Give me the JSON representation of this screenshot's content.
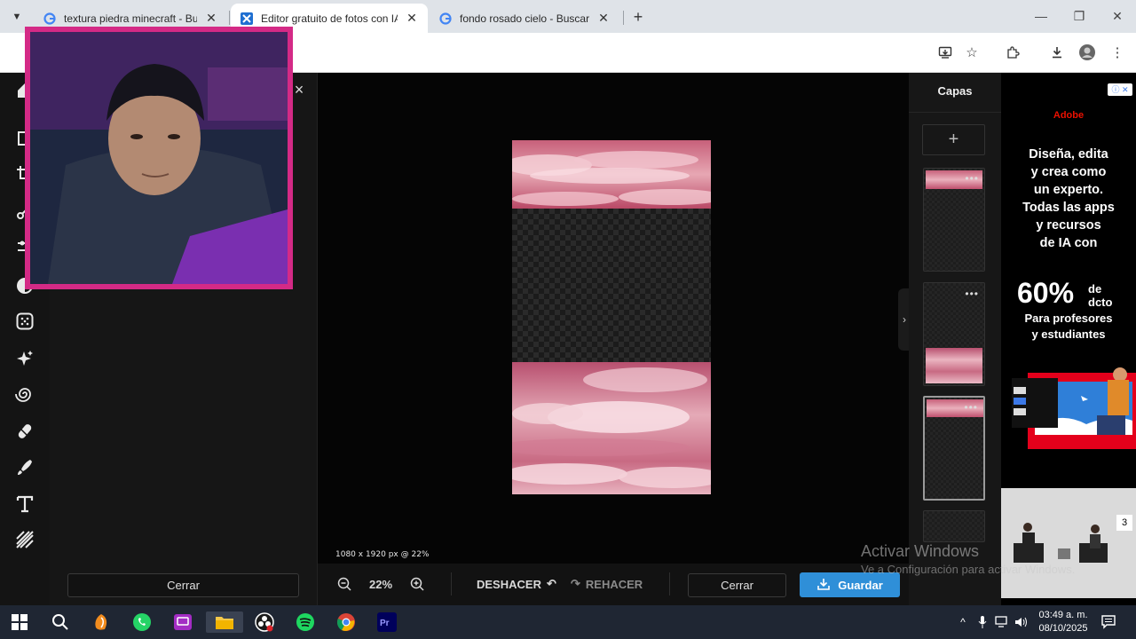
{
  "browser": {
    "tabs": [
      {
        "title": "textura piedra minecraft - Buscar con Google",
        "favicon": "google-icon",
        "active": false
      },
      {
        "title": "Editor gratuito de fotos con IA: Pixlr",
        "favicon": "pixlr-icon",
        "active": true
      },
      {
        "title": "fondo rosado cielo - Buscar con Google",
        "favicon": "google-icon",
        "active": false
      }
    ],
    "new_tab_label": "+",
    "toolbar_icons": [
      "install-app-icon",
      "bookmark-star-icon",
      "extensions-icon",
      "downloads-icon",
      "profile-avatar",
      "menu-kebab-icon"
    ]
  },
  "editor": {
    "left_panel": {
      "close_label": "×",
      "cerrar_label": "Cerrar"
    },
    "tools": [
      "home-icon",
      "arrange-tool-icon",
      "crop-tool-icon",
      "cutout-tool-icon",
      "adjust-tool-icon",
      "filter-tool-icon",
      "effects-tool-icon",
      "ai-tool-icon",
      "liquify-tool-icon",
      "retouch-tool-icon",
      "draw-tool-icon",
      "text-tool-icon",
      "pattern-tool-icon"
    ],
    "canvas": {
      "size_label": "1080 x 1920 px @ 22%"
    },
    "bottom_bar": {
      "zoom_value": "22%",
      "undo_label": "DESHACER",
      "redo_label": "REHACER",
      "cerrar_label": "Cerrar",
      "guardar_label": "Guardar"
    },
    "layers": {
      "title": "Capas",
      "add_label": "+",
      "more_label": "•••"
    }
  },
  "ad": {
    "info_label": "ⓘ ✕",
    "brand": "Adobe",
    "headline": [
      "Diseña, edita",
      "y crea como",
      "un experto.",
      "Todas las apps",
      "y recursos",
      "de IA con"
    ],
    "discount": "60%",
    "discount_suffix_1": "de",
    "discount_suffix_2": "dcto",
    "sub": [
      "Para profesores",
      "y estudiantes"
    ],
    "video_counter": "3"
  },
  "windows": {
    "watermark_title": "Activar Windows",
    "watermark_sub": "Ve a Configuración para activar Windows.",
    "clock_time": "03:49 a. m.",
    "clock_date": "08/10/2025"
  }
}
